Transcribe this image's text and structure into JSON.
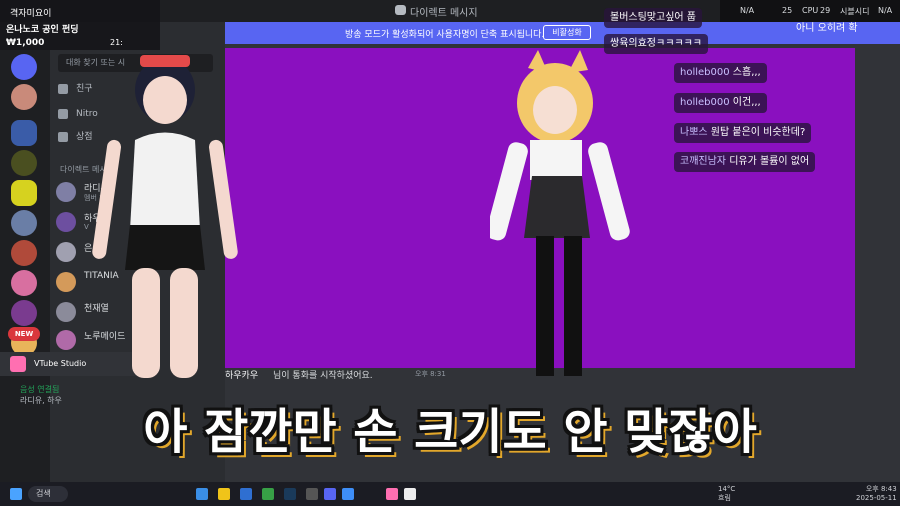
{
  "window": {
    "app_title": "다이렉트 메시지"
  },
  "overlay_top_left": {
    "line1": "격자미요이",
    "line2": "온나노코 공인 펀딩",
    "line3": "₩1,000",
    "clock": "21:"
  },
  "channels": {
    "search_placeholder": "대화 찾기 또는 시",
    "nav": [
      "친구",
      "Nitro",
      "상점"
    ],
    "dm_header": "다이렉트 메시지",
    "dms": [
      {
        "name": "라디유",
        "sub": "멤버 3명"
      },
      {
        "name": "하우",
        "sub": "V"
      },
      {
        "name": "은",
        "sub": ""
      },
      {
        "name": "TITANIA",
        "sub": ""
      },
      {
        "name": "천재열",
        "sub": ""
      },
      {
        "name": "노루메이드",
        "sub": ""
      }
    ],
    "new_badge": "NEW",
    "vtube_label": "VTube Studio",
    "voice": {
      "title": "음성 연결됨",
      "members": "라디유, 하우"
    },
    "bottom_user": "나"
  },
  "notice": {
    "message": "방송 모드가 활성화되어 사용자명이 단축 표시됩니다.",
    "button": "비활성화"
  },
  "chat_line": {
    "name": "하우카우",
    "text": "님이 통화를 시작하셨어요.",
    "time": "오후 8:31"
  },
  "stream_chat": [
    {
      "user": "",
      "text": "볼버스팅맞고싶어",
      "suffix": "풉"
    },
    {
      "user": "",
      "text": "쌍육의효정",
      "suffix": "ㅋㅋㅋㅋㅋ"
    },
    {
      "user": "",
      "text": "아니 오히려 확"
    },
    {
      "user": "holleb000",
      "text": "스흡,,,"
    },
    {
      "user": "holleb000",
      "text": "이건,,,"
    },
    {
      "user": "나뽀스",
      "text": "원탑 붙은이 비슷한데?"
    },
    {
      "user": "코깨진남자",
      "text": "디유가 볼륨이 없어"
    }
  ],
  "perf": {
    "gpu": "N/A",
    "cpu_label": "CPU",
    "cpu_val": "29",
    "gpu_val": "25",
    "temp_label": "시블시디",
    "temp_val": "N/A"
  },
  "subtitle": "아 잠깐만 손 크기도 안 맞잖아",
  "taskbar": {
    "search": "검색",
    "weather_temp": "14°C",
    "weather_desc": "흐림",
    "time": "오후 8:43",
    "date": "2025-05-11"
  },
  "colors": {
    "stream_bg": "#8a10bf",
    "accent": "#5865f2",
    "subtitle_shadow": "#e2a72b"
  }
}
